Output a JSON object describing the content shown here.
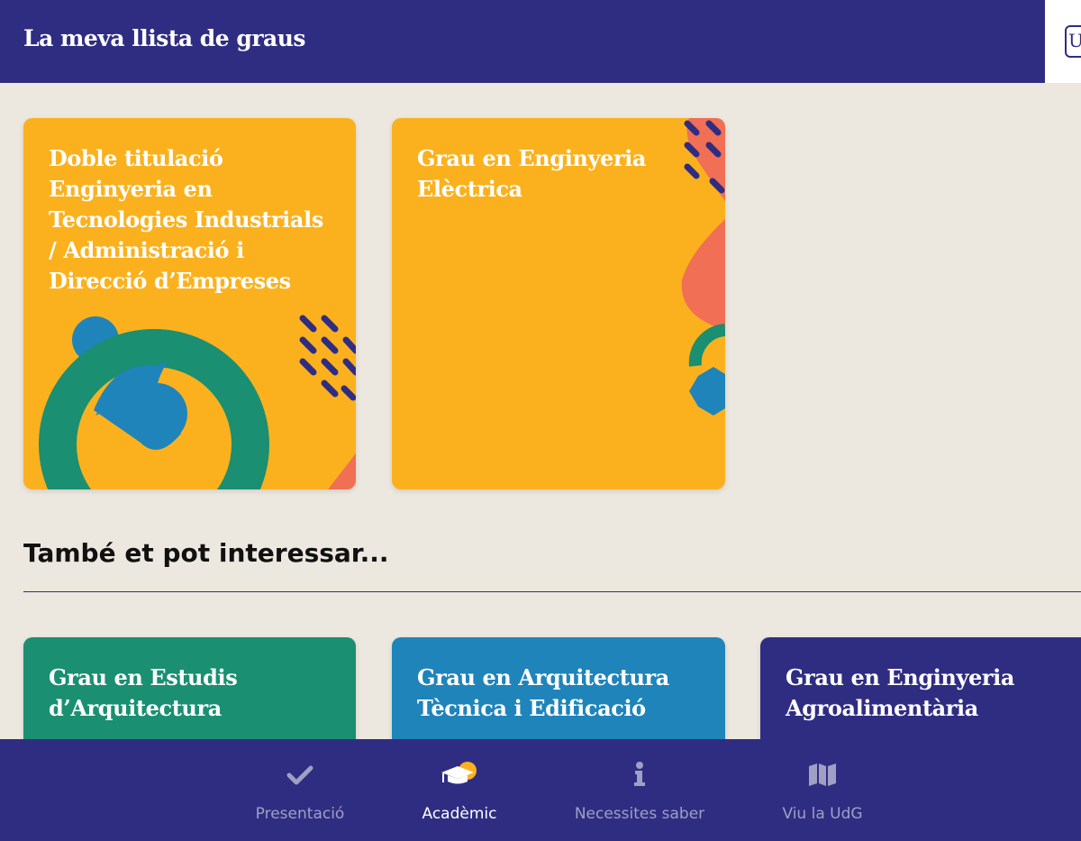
{
  "header": {
    "title": "La meva llista de graus",
    "logo_text": "U"
  },
  "my_list": {
    "cards": [
      {
        "title": "Doble titulació Enginyeria en Tecnologies Industrials / Administració i Direcció d’Empreses",
        "color": "#fbb11e"
      },
      {
        "title": "Grau en Enginyeria Elèctrica",
        "color": "#fbb11e"
      }
    ]
  },
  "suggestions": {
    "title": "També et pot interessar...",
    "cards": [
      {
        "title": "Grau en Estudis d’Arquitectura",
        "color": "#1a8f72"
      },
      {
        "title": "Grau en Arquitectura Tècnica i Edificació",
        "color": "#1f84ba"
      },
      {
        "title": "Grau en Enginyeria Agroalimentària",
        "color": "#2f2d82"
      }
    ]
  },
  "bottom_nav": {
    "items": [
      {
        "label": "Presentació",
        "icon": "checkmark-icon",
        "active": false
      },
      {
        "label": "Acadèmic",
        "icon": "graduation-cap-icon",
        "active": true
      },
      {
        "label": "Necessites saber",
        "icon": "info-icon",
        "active": false
      },
      {
        "label": "Viu la UdG",
        "icon": "map-icon",
        "active": false
      }
    ]
  },
  "colors": {
    "primary": "#2f2d82",
    "background": "#ece8df",
    "yellow": "#fbb11e",
    "green": "#1a8f72",
    "blue": "#1f84ba",
    "coral": "#f06f55",
    "nav_inactive": "#a09fc4"
  }
}
